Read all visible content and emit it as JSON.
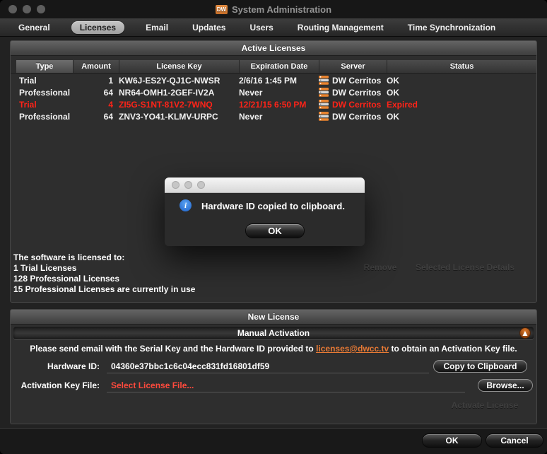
{
  "window": {
    "title": "System Administration",
    "logo_text": "DW"
  },
  "tabs": [
    {
      "label": "General",
      "selected": false
    },
    {
      "label": "Licenses",
      "selected": true
    },
    {
      "label": "Email",
      "selected": false
    },
    {
      "label": "Updates",
      "selected": false
    },
    {
      "label": "Users",
      "selected": false
    },
    {
      "label": "Routing Management",
      "selected": false
    },
    {
      "label": "Time Synchronization",
      "selected": false
    }
  ],
  "active_licenses": {
    "title": "Active Licenses",
    "columns": {
      "type": "Type",
      "amount": "Amount",
      "key": "License Key",
      "expiration": "Expiration Date",
      "server": "Server",
      "status": "Status"
    },
    "rows": [
      {
        "type": "Trial",
        "amount": "1",
        "key": "KW6J-ES2Y-QJ1C-NWSR",
        "expiration": "2/6/16 1:45 PM",
        "server": "DW Cerritos",
        "status": "OK",
        "expired": false
      },
      {
        "type": "Professional",
        "amount": "64",
        "key": "NR64-OMH1-2GEF-IV2A",
        "expiration": "Never",
        "server": "DW Cerritos",
        "status": "OK",
        "expired": false
      },
      {
        "type": "Trial",
        "amount": "4",
        "key": "ZI5G-S1NT-81V2-7WNQ",
        "expiration": "12/21/15 6:50 PM",
        "server": "DW Cerritos",
        "status": "Expired",
        "expired": true
      },
      {
        "type": "Professional",
        "amount": "64",
        "key": "ZNV3-YO41-KLMV-URPC",
        "expiration": "Never",
        "server": "DW Cerritos",
        "status": "OK",
        "expired": false
      }
    ],
    "summary_lines": {
      "l1": "The software is licensed to:",
      "l2": "1 Trial Licenses",
      "l3": "128 Professional Licenses",
      "l4": "15 Professional Licenses are currently in use"
    },
    "remove_label": "Remove",
    "details_label": "Selected License Details"
  },
  "dialog": {
    "message": "Hardware ID copied to clipboard.",
    "ok_label": "OK"
  },
  "new_license": {
    "title": "New License",
    "section_label": "Manual Activation",
    "instruction_prefix": "Please send email with the Serial Key and the Hardware ID provided to ",
    "link_text": "licenses@dwcc.tv",
    "instruction_suffix": " to obtain an Activation Key file.",
    "hardware_id_label": "Hardware ID:",
    "hardware_id_value": "04360e37bbc1c6c04ecc831fd16801df59",
    "copy_button_label": "Copy to Clipboard",
    "key_file_label": "Activation Key File:",
    "key_file_value": "Select License File...",
    "browse_button_label": "Browse...",
    "activate_button_label": "Activate License"
  },
  "footer": {
    "ok_label": "OK",
    "cancel_label": "Cancel"
  },
  "icons": {
    "logo": "dw-logo-icon",
    "server": "server-rack-icon",
    "info": "info-circle-icon",
    "disclosure": "triangle-up-icon",
    "window_controls": "traffic-light-icons"
  },
  "colors": {
    "accent_orange": "#e8832f",
    "expired_red": "#ff2318",
    "file_red": "#ff4a3d",
    "link_orange": "#e87a35",
    "info_blue": "#2e7de9"
  }
}
